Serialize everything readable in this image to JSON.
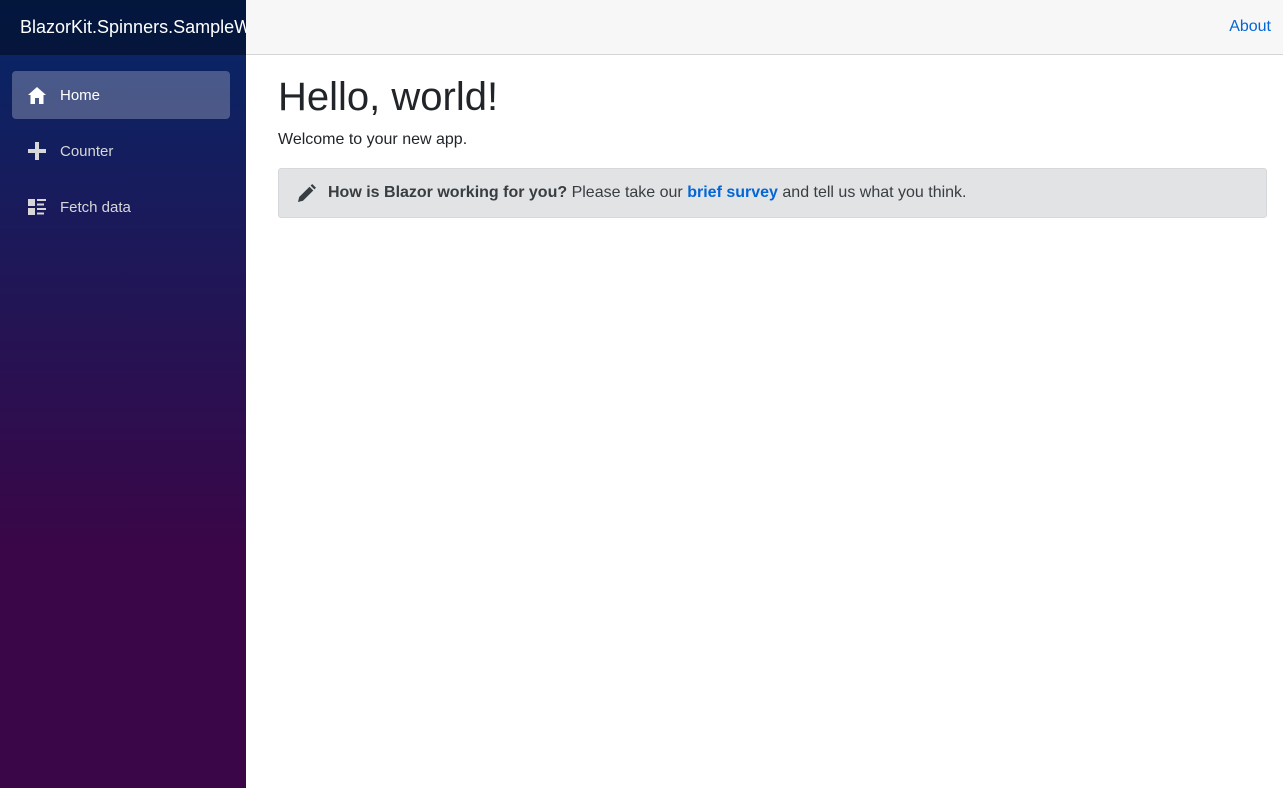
{
  "brand": {
    "title": "BlazorKit.Spinners.SampleWasm"
  },
  "nav": {
    "items": [
      {
        "label": "Home",
        "icon": "home-icon",
        "active": true
      },
      {
        "label": "Counter",
        "icon": "plus-icon",
        "active": false
      },
      {
        "label": "Fetch data",
        "icon": "list-rich-icon",
        "active": false
      }
    ]
  },
  "top_row": {
    "about_label": "About"
  },
  "main": {
    "title": "Hello, world!",
    "welcome": "Welcome to your new app.",
    "survey": {
      "icon": "pencil-icon",
      "question": "How is Blazor working for you?",
      "before_link": "Please take our",
      "link_text": "brief survey",
      "after_link": "and tell us what you think."
    }
  },
  "colors": {
    "sidebar_top": "#052767",
    "sidebar_bottom": "#3a0647",
    "link": "#0366d6",
    "alert_bg": "#e2e3e5"
  }
}
